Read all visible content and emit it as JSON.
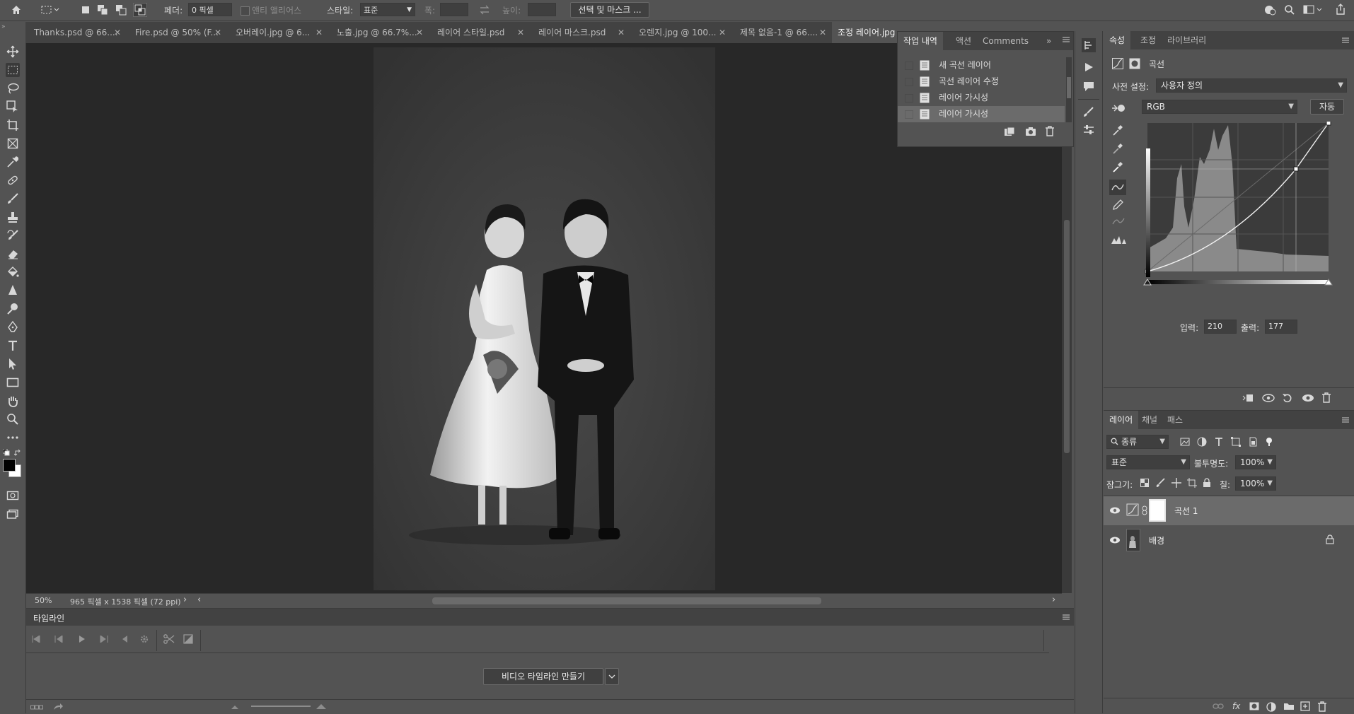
{
  "optbar": {
    "feather_label": "페더:",
    "feather_value": "0 픽셀",
    "antialias_label": "앤티 앨리어스",
    "style_label": "스타일:",
    "style_value": "표준",
    "width_label": "폭:",
    "height_label": "높이:",
    "select_mask_button": "선택 및 마스크 ..."
  },
  "tabs": [
    {
      "label": "Thanks.psd @ 66...."
    },
    {
      "label": "Fire.psd @ 50% (F..."
    },
    {
      "label": "오버레이.jpg @ 6..."
    },
    {
      "label": "노출.jpg @ 66.7%..."
    },
    {
      "label": "레이어 스타일.psd"
    },
    {
      "label": "레이어 마스크.psd"
    },
    {
      "label": "오렌지.jpg @ 100..."
    },
    {
      "label": "제목 없음-1 @ 66...."
    },
    {
      "label": "조정 레이어.jpg"
    }
  ],
  "status": {
    "zoom": "50%",
    "doc_info": "965 픽셀 x 1538 픽셀 (72 ppi)"
  },
  "history": {
    "tabs": [
      "작업 내역",
      "액션",
      "Comments"
    ],
    "items": [
      {
        "label": "새 곡선 레이어"
      },
      {
        "label": "곡선 레이어 수정"
      },
      {
        "label": "레이어 가시성"
      },
      {
        "label": "레이어 가시성"
      }
    ]
  },
  "properties": {
    "tabs": [
      "속성",
      "조정",
      "라이브러리"
    ],
    "title": "곡선",
    "preset_label": "사전 설정:",
    "preset_value": "사용자 정의",
    "channel_value": "RGB",
    "auto_button": "자동",
    "input_label": "입력:",
    "input_value": "210",
    "output_label": "출력:",
    "output_value": "177"
  },
  "layers": {
    "tabs": [
      "레이어",
      "채널",
      "패스"
    ],
    "filter_kind": "종류",
    "blend_mode": "표준",
    "opacity_label": "불투명도:",
    "opacity_value": "100%",
    "lock_label": "잠그기:",
    "fill_label": "칠:",
    "fill_value": "100%",
    "items": [
      {
        "name": "곡선 1",
        "visible": true,
        "selected": true
      },
      {
        "name": "배경",
        "visible": true,
        "locked": true
      }
    ]
  },
  "timeline": {
    "title": "타임라인",
    "create_button": "비디오 타임라인 만들기"
  },
  "icons": {
    "home": "home-icon",
    "search": "search-icon",
    "share": "share-icon"
  }
}
